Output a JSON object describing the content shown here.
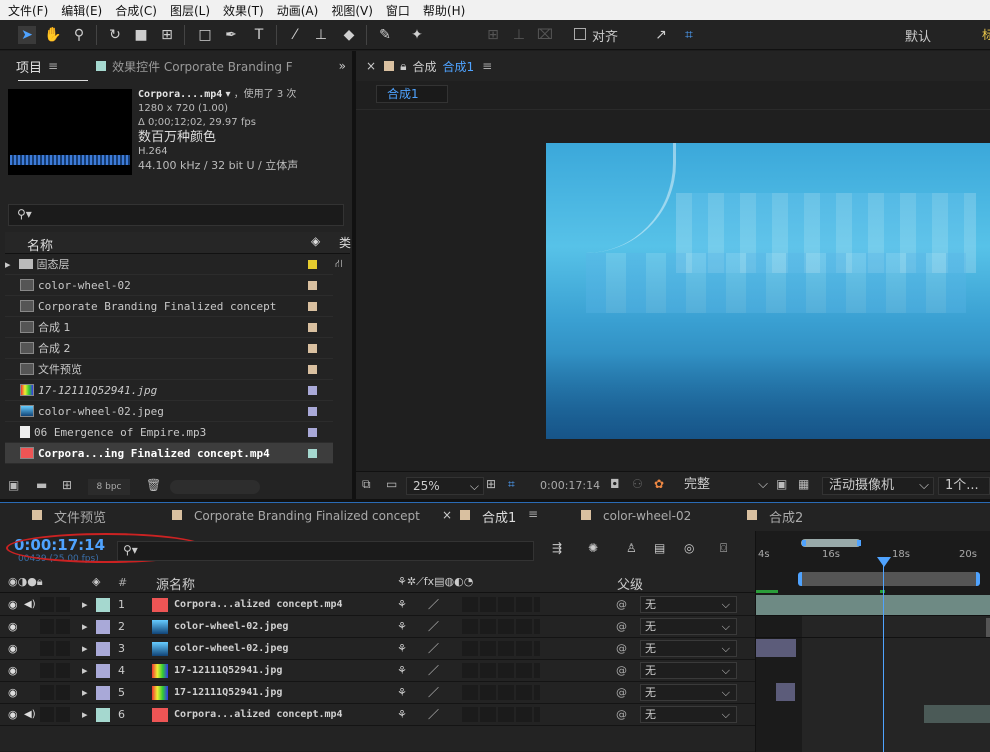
{
  "menu": [
    "文件(F)",
    "编辑(E)",
    "合成(C)",
    "图层(L)",
    "效果(T)",
    "动画(A)",
    "视图(V)",
    "窗口",
    "帮助(H)"
  ],
  "toolbar": {
    "align_label": "对齐",
    "workspace": "默认"
  },
  "project_panel": {
    "tab_project": "项目",
    "tab_effects": "效果控件 Corporate Branding F",
    "info": {
      "name": "Corpora....mp4",
      "usage": "，使用了 3 次",
      "res": "1280 x 720 (1.00)",
      "dur": "Δ 0;00;12;02, 29.97 fps",
      "colors": "数百万种颜色",
      "codec": "H.264",
      "audio": "44.100 kHz / 32 bit U / 立体声"
    },
    "search_placeholder": "",
    "col_name": "名称",
    "col_type": "类",
    "items": [
      {
        "label": "固态层",
        "tag": "#e6cc2e",
        "mono": false
      },
      {
        "label": "color-wheel-02",
        "tag": "#d9c0a0",
        "mono": true
      },
      {
        "label": "Corporate Branding  Finalized concept",
        "tag": "#d9c0a0",
        "mono": true
      },
      {
        "label": "合成 1",
        "tag": "#d9c0a0",
        "mono": false
      },
      {
        "label": "合成 2",
        "tag": "#d9c0a0",
        "mono": false
      },
      {
        "label": "文件预览",
        "tag": "#d9c0a0",
        "mono": false
      },
      {
        "label": "17-12111Q52941.jpg",
        "tag": "#a9a9d8",
        "mono": true
      },
      {
        "label": "color-wheel-02.jpeg",
        "tag": "#a9a9d8",
        "mono": true
      },
      {
        "label": "06 Emergence of Empire.mp3",
        "tag": "#a9a9d8",
        "mono": true
      },
      {
        "label": "Corpora...ing  Finalized concept.mp4",
        "tag": "#a5d8cf",
        "mono": true
      }
    ],
    "bpc": "8 bpc"
  },
  "comp_panel": {
    "tab_label": "合成",
    "tab_name": "合成1",
    "subtab": "合成1",
    "zoom": "25%",
    "timecode": "0:00:17:14",
    "quality": "完整",
    "camera": "活动摄像机",
    "views": "1个..."
  },
  "timeline": {
    "tabs": [
      {
        "label": "文件预览",
        "color": "#d9c0a0"
      },
      {
        "label": "Corporate Branding  Finalized concept",
        "color": "#d9c0a0"
      },
      {
        "label": "合成1",
        "color": "#d9c0a0"
      },
      {
        "label": "color-wheel-02",
        "color": "#d9c0a0"
      },
      {
        "label": "合成2",
        "color": "#d9c0a0"
      }
    ],
    "timecode": "0:00:17:14",
    "frames": "00439 (25.00 fps)",
    "col_num": "#",
    "col_source": "源名称",
    "col_parent": "父级",
    "ruler": [
      "4s",
      "16s",
      "18s",
      "20s"
    ],
    "layers": [
      {
        "num": "1",
        "name": "Corpora...alized concept.mp4",
        "color": "#a5d8cf",
        "parent": "无"
      },
      {
        "num": "2",
        "name": "color-wheel-02.jpeg",
        "color": "#a9a9d8",
        "parent": "无"
      },
      {
        "num": "3",
        "name": "color-wheel-02.jpeg",
        "color": "#a9a9d8",
        "parent": "无"
      },
      {
        "num": "4",
        "name": "17-12111Q52941.jpg",
        "color": "#a9a9d8",
        "parent": "无"
      },
      {
        "num": "5",
        "name": "17-12111Q52941.jpg",
        "color": "#a9a9d8",
        "parent": "无"
      },
      {
        "num": "6",
        "name": "Corpora...alized concept.mp4",
        "color": "#a5d8cf",
        "parent": "无"
      }
    ]
  }
}
